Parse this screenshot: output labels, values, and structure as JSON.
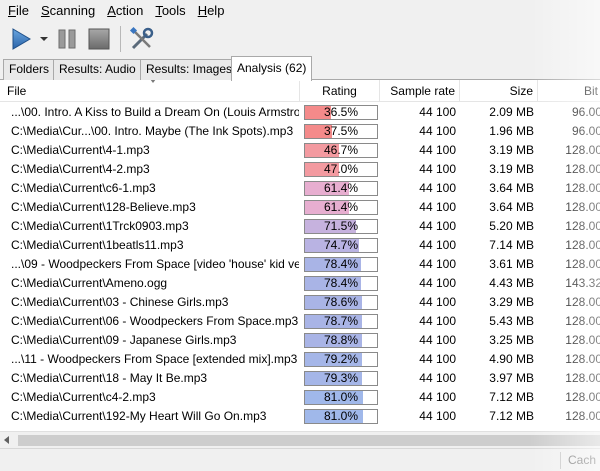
{
  "menu": {
    "items": [
      {
        "pre": "",
        "u": "F",
        "post": "ile"
      },
      {
        "pre": "",
        "u": "S",
        "post": "canning"
      },
      {
        "pre": "",
        "u": "A",
        "post": "ction"
      },
      {
        "pre": "",
        "u": "T",
        "post": "ools"
      },
      {
        "pre": "",
        "u": "H",
        "post": "elp"
      }
    ]
  },
  "toolbar": {
    "icons": [
      "play-icon",
      "dropdown-arrow-icon",
      "pause-icon",
      "stop-icon",
      "tools-icon"
    ],
    "colors": {
      "play": "#3a7dc6",
      "pause": "#8a8a8a",
      "stop": "#7a7a7a"
    }
  },
  "tabs": [
    {
      "label": "Folders"
    },
    {
      "label": "Results: Audio"
    },
    {
      "label": "Results: Images"
    },
    {
      "label": "Analysis (62)",
      "active": true
    }
  ],
  "columns": {
    "file": "File",
    "rating": "Rating",
    "sample_rate": "Sample rate",
    "size": "Size",
    "bitrate": "Bit"
  },
  "rows": [
    {
      "file": "...\\00. Intro. A Kiss to Build a Dream On (Louis Armstro",
      "rating": "36.5%",
      "pct": 36.5,
      "color": "#f48a8a",
      "sr": "44 100",
      "size": "2.09 MB",
      "bit": "96.00"
    },
    {
      "file": "C:\\Media\\Cur...\\00. Intro. Maybe (The Ink Spots).mp3",
      "rating": "37.5%",
      "pct": 37.5,
      "color": "#f48a8a",
      "sr": "44 100",
      "size": "1.96 MB",
      "bit": "96.00"
    },
    {
      "file": "C:\\Media\\Current\\4-1.mp3",
      "rating": "46.7%",
      "pct": 46.7,
      "color": "#f39aa0",
      "sr": "44 100",
      "size": "3.19 MB",
      "bit": "128.00"
    },
    {
      "file": "C:\\Media\\Current\\4-2.mp3",
      "rating": "47.0%",
      "pct": 47.0,
      "color": "#f39aa0",
      "sr": "44 100",
      "size": "3.19 MB",
      "bit": "128.00"
    },
    {
      "file": "C:\\Media\\Current\\c6-1.mp3",
      "rating": "61.4%",
      "pct": 61.4,
      "color": "#e7aed0",
      "sr": "44 100",
      "size": "3.64 MB",
      "bit": "128.00"
    },
    {
      "file": "C:\\Media\\Current\\128-Believe.mp3",
      "rating": "61.4%",
      "pct": 61.4,
      "color": "#e7aed0",
      "sr": "44 100",
      "size": "3.64 MB",
      "bit": "128.00"
    },
    {
      "file": "C:\\Media\\Current\\1Trck0903.mp3",
      "rating": "71.5%",
      "pct": 71.5,
      "color": "#c6b2de",
      "sr": "44 100",
      "size": "5.20 MB",
      "bit": "128.00"
    },
    {
      "file": "C:\\Media\\Current\\1beatls11.mp3",
      "rating": "74.7%",
      "pct": 74.7,
      "color": "#b9b3e3",
      "sr": "44 100",
      "size": "7.14 MB",
      "bit": "128.00"
    },
    {
      "file": "...\\09 - Woodpeckers From Space [video 'house' kid ve",
      "rating": "78.4%",
      "pct": 78.4,
      "color": "#a9b4e6",
      "sr": "44 100",
      "size": "3.61 MB",
      "bit": "128.00"
    },
    {
      "file": "C:\\Media\\Current\\Ameno.ogg",
      "rating": "78.4%",
      "pct": 78.4,
      "color": "#a9b4e6",
      "sr": "44 100",
      "size": "4.43 MB",
      "bit": "143.32"
    },
    {
      "file": "C:\\Media\\Current\\03 - Chinese Girls.mp3",
      "rating": "78.6%",
      "pct": 78.6,
      "color": "#a9b4e6",
      "sr": "44 100",
      "size": "3.29 MB",
      "bit": "128.00"
    },
    {
      "file": "C:\\Media\\Current\\06 - Woodpeckers From Space.mp3",
      "rating": "78.7%",
      "pct": 78.7,
      "color": "#a9b4e6",
      "sr": "44 100",
      "size": "5.43 MB",
      "bit": "128.00"
    },
    {
      "file": "C:\\Media\\Current\\09 - Japanese Girls.mp3",
      "rating": "78.8%",
      "pct": 78.8,
      "color": "#a9b4e6",
      "sr": "44 100",
      "size": "3.25 MB",
      "bit": "128.00"
    },
    {
      "file": "...\\11 - Woodpeckers From Space [extended mix].mp3",
      "rating": "79.2%",
      "pct": 79.2,
      "color": "#a5b6e8",
      "sr": "44 100",
      "size": "4.90 MB",
      "bit": "128.00"
    },
    {
      "file": "C:\\Media\\Current\\18 - May It Be.mp3",
      "rating": "79.3%",
      "pct": 79.3,
      "color": "#a5b6e8",
      "sr": "44 100",
      "size": "3.97 MB",
      "bit": "128.00"
    },
    {
      "file": "C:\\Media\\Current\\c4-2.mp3",
      "rating": "81.0%",
      "pct": 81.0,
      "color": "#a0b8ea",
      "sr": "44 100",
      "size": "7.12 MB",
      "bit": "128.00"
    },
    {
      "file": "C:\\Media\\Current\\192-My Heart Will Go On.mp3",
      "rating": "81.0%",
      "pct": 81.0,
      "color": "#a0b8ea",
      "sr": "44 100",
      "size": "7.12 MB",
      "bit": "128.00"
    }
  ],
  "status": {
    "text": "Cach"
  }
}
